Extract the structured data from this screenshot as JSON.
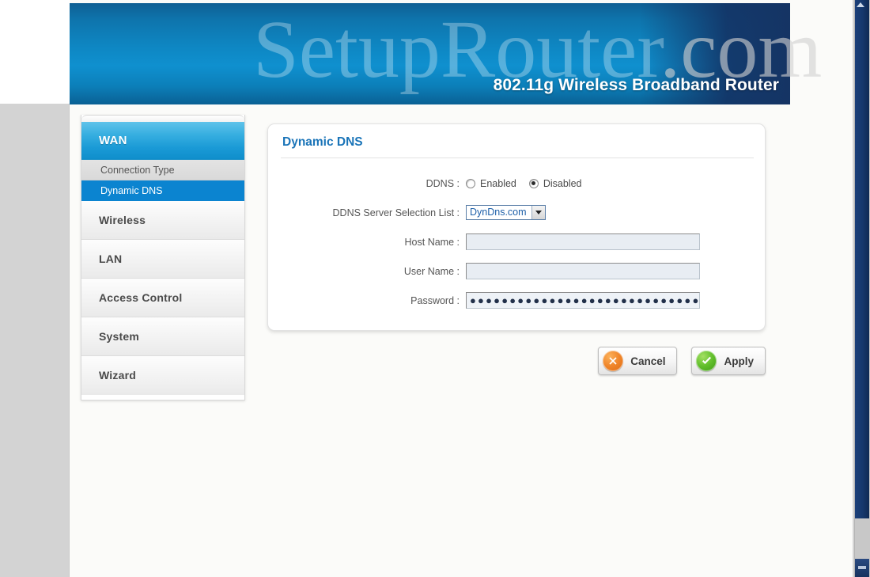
{
  "header": {
    "watermark_main": "SetupRouter",
    "watermark_tail": ".com",
    "product_title": "802.11g Wireless Broadband Router",
    "banner_color": "#0e86c2"
  },
  "sidebar": {
    "section_header": {
      "label": "WAN",
      "accent": "#1a9ad6"
    },
    "sub_items": [
      {
        "label": "Connection Type",
        "selected": false
      },
      {
        "label": "Dynamic DNS",
        "selected": true
      }
    ],
    "items": [
      {
        "label": "Wireless"
      },
      {
        "label": "LAN"
      },
      {
        "label": "Access Control"
      },
      {
        "label": "System"
      },
      {
        "label": "Wizard"
      }
    ],
    "selected_color": "#0b84d0"
  },
  "content": {
    "title": "Dynamic DNS",
    "title_color": "#1a74b8",
    "rows": {
      "ddns": {
        "label": "DDNS :",
        "options": [
          {
            "label": "Enabled",
            "checked": false
          },
          {
            "label": "Disabled",
            "checked": true
          }
        ]
      },
      "server_list": {
        "label": "DDNS Server Selection List :",
        "value": "DynDns.com",
        "options": [
          "DynDns.com"
        ]
      },
      "host_name": {
        "label": "Host Name :",
        "value": "",
        "placeholder": ""
      },
      "user_name": {
        "label": "User Name :",
        "value": "",
        "placeholder": ""
      },
      "password": {
        "label": "Password :",
        "value": "●●●●●●●●●●●●●●●●●●●●●●●●●●●●●●●●",
        "placeholder": ""
      }
    }
  },
  "actions": {
    "cancel": {
      "label": "Cancel",
      "icon": "cancel-x-icon",
      "color": "#f0862a"
    },
    "apply": {
      "label": "Apply",
      "icon": "check-icon",
      "color": "#62bf2c"
    }
  },
  "scrollbar": {
    "orientation": "vertical",
    "thumb_color": "#16386c",
    "track_color": "#c8c8c8"
  }
}
